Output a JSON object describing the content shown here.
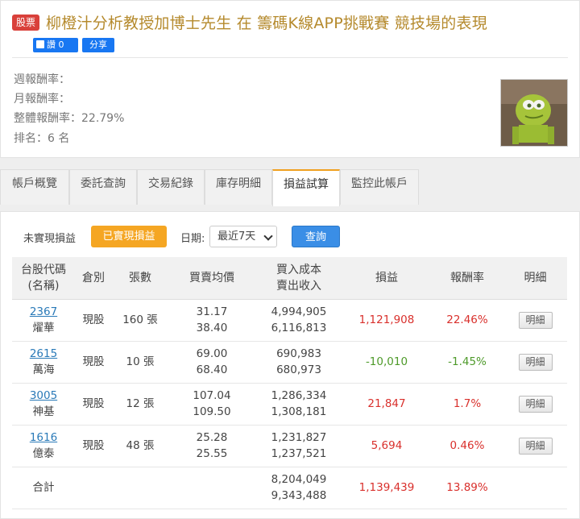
{
  "header": {
    "tag": "股票",
    "title": "柳橙汁分析教授加博士先生 在 籌碼K線APP挑戰賽 競技場的表現",
    "like_label": "讚 0",
    "share_label": "分享"
  },
  "stats": {
    "weekly": "週報酬率：",
    "monthly": "月報酬率：",
    "overall": "整體報酬率：22.79%",
    "rank": "排名：6 名"
  },
  "tabs": [
    {
      "label": "帳戶概覽"
    },
    {
      "label": "委託查詢"
    },
    {
      "label": "交易紀錄"
    },
    {
      "label": "庫存明細"
    },
    {
      "label": "損益試算",
      "active": true
    },
    {
      "label": "監控此帳戶"
    }
  ],
  "filter": {
    "unrealized": "未實現損益",
    "realized": "已實現損益",
    "date_label": "日期:",
    "date_value": "最近7天",
    "query": "查詢"
  },
  "table": {
    "headers": {
      "code": "台股代碼",
      "code_sub": "(名稱)",
      "type": "倉別",
      "qty": "張數",
      "price": "買賣均價",
      "cost": "買入成本",
      "cost_sub": "賣出收入",
      "pnl": "損益",
      "rate": "報酬率",
      "detail": "明細"
    },
    "rows": [
      {
        "code": "2367",
        "name": "燿華",
        "type": "現股",
        "qty": "160 張",
        "buy_price": "31.17",
        "sell_price": "38.40",
        "cost": "4,994,905",
        "income": "6,116,813",
        "pnl": "1,121,908",
        "rate": "22.46%",
        "detail": "明細",
        "sign": "red"
      },
      {
        "code": "2615",
        "name": "萬海",
        "type": "現股",
        "qty": "10 張",
        "buy_price": "69.00",
        "sell_price": "68.40",
        "cost": "690,983",
        "income": "680,973",
        "pnl": "-10,010",
        "rate": "-1.45%",
        "detail": "明細",
        "sign": "green"
      },
      {
        "code": "3005",
        "name": "神基",
        "type": "現股",
        "qty": "12 張",
        "buy_price": "107.04",
        "sell_price": "109.50",
        "cost": "1,286,334",
        "income": "1,308,181",
        "pnl": "21,847",
        "rate": "1.7%",
        "detail": "明細",
        "sign": "red"
      },
      {
        "code": "1616",
        "name": "億泰",
        "type": "現股",
        "qty": "48 張",
        "buy_price": "25.28",
        "sell_price": "25.55",
        "cost": "1,231,827",
        "income": "1,237,521",
        "pnl": "5,694",
        "rate": "0.46%",
        "detail": "明細",
        "sign": "red"
      }
    ],
    "total": {
      "label": "合計",
      "cost": "8,204,049",
      "income": "9,343,488",
      "pnl": "1,139,439",
      "rate": "13.89%"
    }
  },
  "colors": {
    "accent": "#f5a623",
    "primary": "#3a8ee6",
    "profit": "#d9302c",
    "loss": "#4e9a2a"
  }
}
